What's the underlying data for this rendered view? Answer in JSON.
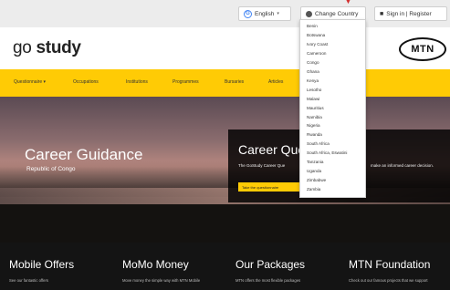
{
  "topbar": {
    "language_label": "English",
    "country_label": "Change Country",
    "signin_label": "Sign in | Register",
    "language_icon": "google-g-icon",
    "country_icon": "globe-icon",
    "signin_icon": "user-icon"
  },
  "header": {
    "logo_part1": "go",
    "logo_part2": "study",
    "mtn_label": "MTN"
  },
  "nav": {
    "items": [
      "Questionnaire",
      "Occupations",
      "Institutions",
      "Programmes",
      "Bursaries",
      "Articles"
    ]
  },
  "hero": {
    "title": "Career Guidance",
    "subtitle": "Republic of Congo"
  },
  "quiz": {
    "title": "Career Que",
    "desc_left": "The GoStudy Career Que",
    "desc_right": "make an informed career decision.",
    "button_label": "Take the questionnaire"
  },
  "countries": [
    "Benin",
    "Botswana",
    "Ivory Coast",
    "Cameroon",
    "Congo",
    "Ghana",
    "Kenya",
    "Lesotho",
    "Malawi",
    "Mauritius",
    "Namibia",
    "Nigeria",
    "Rwanda",
    "South Africa",
    "South Africa, Eswatini",
    "Tanzania",
    "Uganda",
    "Zimbabwe",
    "Zambia"
  ],
  "footer": {
    "columns": [
      {
        "title": "Mobile Offers",
        "text": "See our fantastic offers"
      },
      {
        "title": "MoMo Money",
        "text": "Move money the simple way with MTN Mobile"
      },
      {
        "title": "Our Packages",
        "text": "MTN offers the most flexible packages"
      },
      {
        "title": "MTN Foundation",
        "text": "Check out our famous projects that we support"
      }
    ]
  },
  "colors": {
    "accent_yellow": "#ffcb05",
    "dark": "#141414"
  }
}
